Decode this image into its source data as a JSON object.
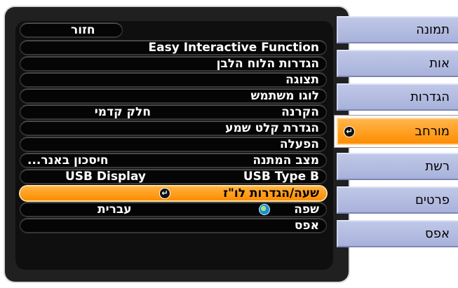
{
  "menu": {
    "back_label": "חזור",
    "items": [
      {
        "label": "Easy Interactive Function",
        "value": ""
      },
      {
        "label": "הגדרות הלוח הלבן",
        "value": ""
      },
      {
        "label": "תצוגה",
        "value": ""
      },
      {
        "label": "לוגו משתמש",
        "value": ""
      },
      {
        "label": "הקרנה",
        "value": "חלק קדמי"
      },
      {
        "label": "הגדרת קלט שמע",
        "value": ""
      },
      {
        "label": "הפעלה",
        "value": ""
      },
      {
        "label": "מצב המתנה",
        "value": "חיסכון באנר..."
      },
      {
        "label": "USB Type B",
        "value": "USB Display"
      },
      {
        "label": "שעה/הגדרות לו\"ז",
        "value": ""
      },
      {
        "label": "שפה",
        "value": "עברית"
      },
      {
        "label": "אפס",
        "value": ""
      }
    ],
    "selected_item": "שעה/הגדרות לו\"ז"
  },
  "tabs": [
    {
      "label": "תמונה",
      "active": false
    },
    {
      "label": "אות",
      "active": false
    },
    {
      "label": "הגדרות",
      "active": false
    },
    {
      "label": "מורחב",
      "active": true
    },
    {
      "label": "רשת",
      "active": false
    },
    {
      "label": "פרטים",
      "active": false
    },
    {
      "label": "אפס",
      "active": false
    }
  ],
  "colors": {
    "accent": "#ff9a1a",
    "tab_bg": "#b4bde0",
    "panel_bg": "#1b1b1b"
  },
  "icons": {
    "enter": "enter-icon",
    "language": "globe-icon"
  }
}
